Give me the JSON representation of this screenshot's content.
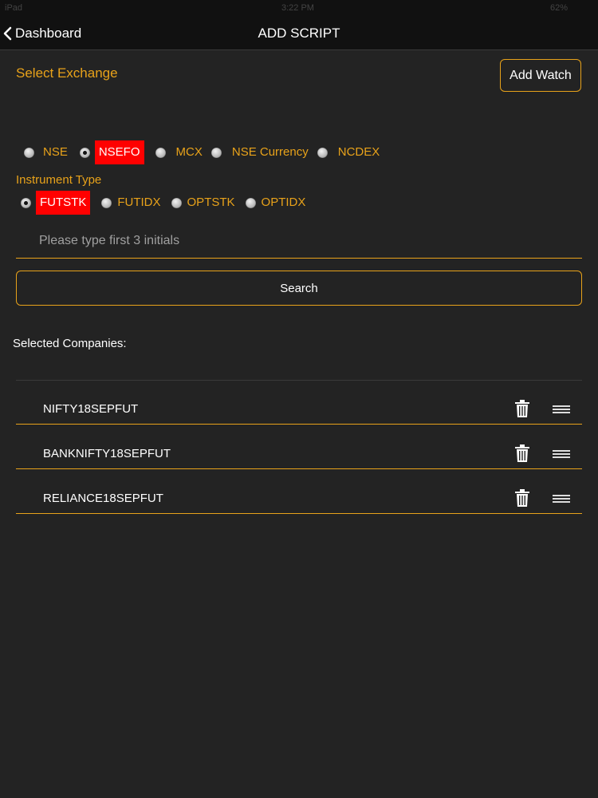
{
  "status_bar": {
    "carrier": "iPad",
    "time": "3:22 PM",
    "battery": "62%"
  },
  "nav": {
    "back_label": "Dashboard",
    "title": "ADD SCRIPT"
  },
  "exchange": {
    "label": "Select Exchange",
    "add_watch_label": "Add Watch",
    "options": [
      {
        "label": "NSE",
        "selected": false
      },
      {
        "label": "NSEFO",
        "selected": true
      },
      {
        "label": "MCX",
        "selected": false
      },
      {
        "label": "NSE Currency",
        "selected": false
      },
      {
        "label": "NCDEX",
        "selected": false
      }
    ]
  },
  "instrument": {
    "label": "Instrument Type",
    "options": [
      {
        "label": "FUTSTK",
        "selected": true
      },
      {
        "label": "FUTIDX",
        "selected": false
      },
      {
        "label": "OPTSTK",
        "selected": false
      },
      {
        "label": "OPTIDX",
        "selected": false
      }
    ]
  },
  "search": {
    "placeholder": "Please type first 3 initials",
    "value": "",
    "button_label": "Search"
  },
  "selected": {
    "label": "Selected Companies:",
    "companies": [
      "NIFTY18SEPFUT",
      "BANKNIFTY18SEPFUT",
      "RELIANCE18SEPFUT"
    ]
  },
  "colors": {
    "accent": "#e8a21a",
    "selected_bg": "#ff0000",
    "background": "#232323"
  }
}
